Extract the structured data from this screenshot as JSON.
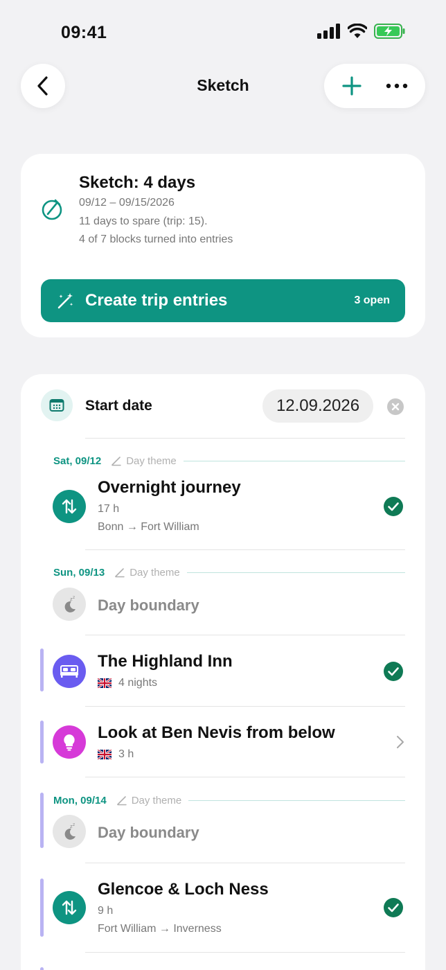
{
  "status_bar": {
    "time": "09:41"
  },
  "nav": {
    "title": "Sketch"
  },
  "summary": {
    "title": "Sketch: 4 days",
    "dates": "09/12 – 09/15/2026",
    "spare": "11 days to spare (trip: 15).",
    "progress": "4 of 7 blocks turned into entries",
    "create_label": "Create trip entries",
    "open_badge": "3 open"
  },
  "start": {
    "label": "Start date",
    "value": "12.09.2026"
  },
  "days": [
    {
      "date": "Sat, 09/12",
      "theme": "Day theme"
    },
    {
      "date": "Sun, 09/13",
      "theme": "Day theme"
    },
    {
      "date": "Mon, 09/14",
      "theme": "Day theme"
    }
  ],
  "items": [
    {
      "title": "Overnight journey",
      "meta": "17 h",
      "route": "Bonn → Fort William",
      "done": true
    },
    {
      "title": "Day boundary"
    },
    {
      "title": "The Highland Inn",
      "meta": "4 nights",
      "done": true
    },
    {
      "title": "Look at Ben Nevis from below",
      "meta": "3 h",
      "done": false
    },
    {
      "title": "Day boundary"
    },
    {
      "title": "Glencoe & Loch Ness",
      "meta": "9 h",
      "route": "Fort William → Inverness",
      "done": true
    }
  ],
  "colors": {
    "accent": "#0e9482",
    "check": "#0f7a55",
    "hotel": "#6a5cf0",
    "activity": "#d63ad8",
    "boundary": "#e6e6e6",
    "sidebar_accent": "#b9b3f3"
  }
}
